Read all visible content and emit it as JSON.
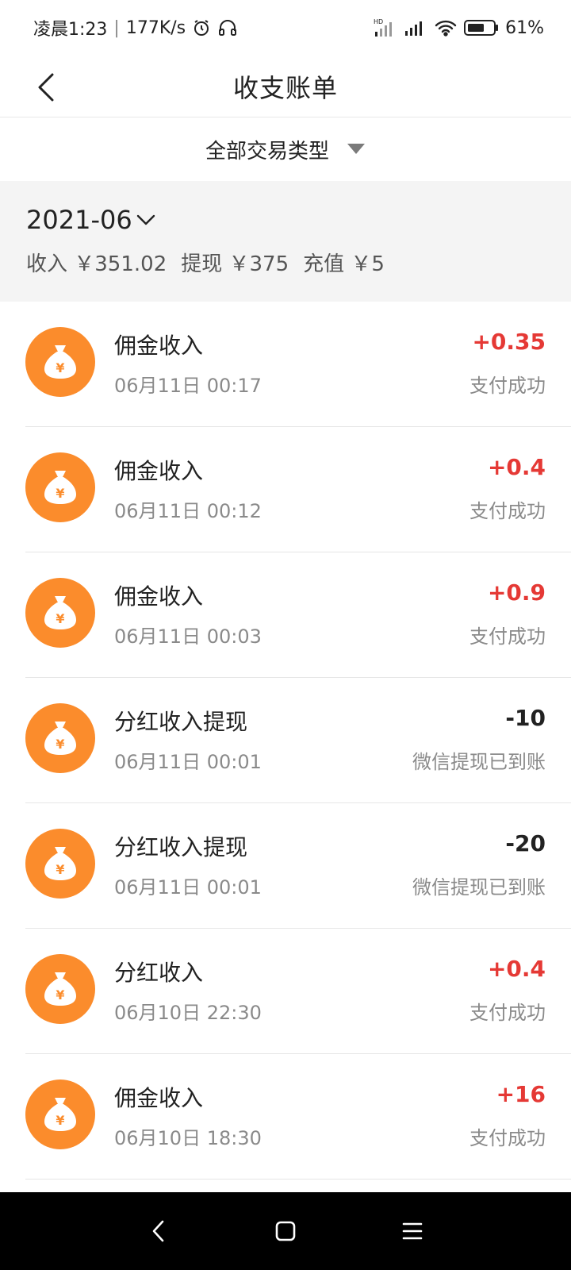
{
  "status_bar": {
    "time": "凌晨1:23",
    "speed": "177K/s",
    "hd_label": "HD",
    "battery": "61%"
  },
  "header": {
    "title": "收支账单"
  },
  "filter": {
    "label": "全部交易类型"
  },
  "summary": {
    "month": "2021-06",
    "income": "收入 ￥351.02",
    "withdraw": "提现 ￥375",
    "recharge": "充值 ￥5"
  },
  "colors": {
    "accent": "#fb8c2c",
    "positive": "#e53935",
    "negative": "#222222"
  },
  "transactions": [
    {
      "title": "佣金收入",
      "date": "06月11日 00:17",
      "amount": "+0.35",
      "status": "支付成功",
      "icon": "money-bag-icon"
    },
    {
      "title": "佣金收入",
      "date": "06月11日 00:12",
      "amount": "+0.4",
      "status": "支付成功",
      "icon": "money-bag-icon"
    },
    {
      "title": "佣金收入",
      "date": "06月11日 00:03",
      "amount": "+0.9",
      "status": "支付成功",
      "icon": "money-bag-icon"
    },
    {
      "title": "分红收入提现",
      "date": "06月11日 00:01",
      "amount": "-10",
      "status": "微信提现已到账",
      "icon": "money-bag-icon"
    },
    {
      "title": "分红收入提现",
      "date": "06月11日 00:01",
      "amount": "-20",
      "status": "微信提现已到账",
      "icon": "money-bag-icon"
    },
    {
      "title": "分红收入",
      "date": "06月10日 22:30",
      "amount": "+0.4",
      "status": "支付成功",
      "icon": "money-bag-icon"
    },
    {
      "title": "佣金收入",
      "date": "06月10日 18:30",
      "amount": "+16",
      "status": "支付成功",
      "icon": "money-bag-icon"
    }
  ]
}
